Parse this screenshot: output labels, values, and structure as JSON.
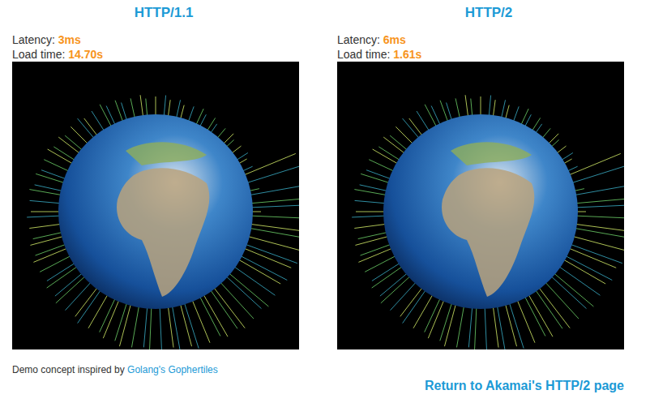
{
  "panels": [
    {
      "title": "HTTP/1.1",
      "latency_label": "Latency:",
      "latency": "3ms",
      "load_label": "Load time:",
      "load_time": "14.70s"
    },
    {
      "title": "HTTP/2",
      "latency_label": "Latency:",
      "latency": "6ms",
      "load_label": "Load time:",
      "load_time": "1.61s"
    }
  ],
  "footer": {
    "credit": "Demo concept inspired by",
    "link": "Golang's Gophertiles"
  },
  "back_link": "Return to Akamai's HTTP/2 page"
}
